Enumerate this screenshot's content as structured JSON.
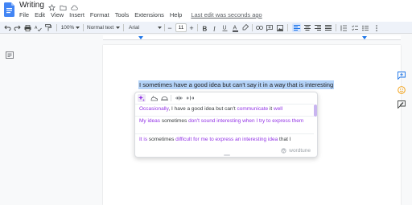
{
  "header": {
    "title": "Writing",
    "menu": [
      "File",
      "Edit",
      "View",
      "Insert",
      "Format",
      "Tools",
      "Extensions",
      "Help"
    ],
    "last_edit": "Last edit was seconds ago"
  },
  "toolbar": {
    "zoom": "100%",
    "style": "Normal text",
    "font": "Arial",
    "font_size": "11"
  },
  "document": {
    "selected_text": "I sometimes have a good idea but can't say it in a way that is interesting"
  },
  "wordtune": {
    "suggestions": [
      {
        "parts": [
          {
            "text": "Occasionally",
            "hl": true
          },
          {
            "text": ", I have a good idea but can't ",
            "hl": false
          },
          {
            "text": "communicate",
            "hl": true
          },
          {
            "text": " it ",
            "hl": false
          },
          {
            "text": "well",
            "hl": true
          }
        ]
      },
      {
        "parts": [
          {
            "text": "My ideas",
            "hl": true
          },
          {
            "text": " sometimes ",
            "hl": false
          },
          {
            "text": "don't sound interesting when I try to express them",
            "hl": true
          }
        ]
      },
      {
        "parts": [
          {
            "text": "It is",
            "hl": true
          },
          {
            "text": " sometimes ",
            "hl": false
          },
          {
            "text": "difficult for me to express an interesting idea",
            "hl": true
          },
          {
            "text": " that I",
            "hl": false
          }
        ]
      }
    ],
    "brand": "wordtune"
  },
  "colors": {
    "accent": "#1a73e8",
    "wordtune_purple": "#9334e6",
    "selection": "#b4d3f8"
  }
}
